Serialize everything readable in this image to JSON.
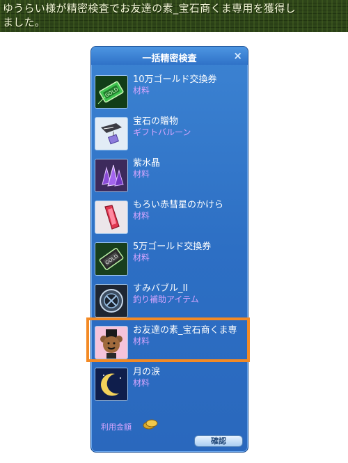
{
  "chat": {
    "message_line1": "ゆうらい様が精密検査でお友達の素_宝石商くま専用を獲得し",
    "message_line2": "ました。"
  },
  "dialog": {
    "title": "一括精密検査",
    "close_label": "×",
    "items": [
      {
        "name": "10万ゴールド交換券",
        "type": "材料",
        "icon": "gold-voucher-icon"
      },
      {
        "name": "宝石の贈物",
        "type": "ギフトバルーン",
        "icon": "gift-balloon-icon"
      },
      {
        "name": "紫水晶",
        "type": "材料",
        "icon": "amethyst-icon"
      },
      {
        "name": "もろい赤彗星のかけら",
        "type": "材料",
        "icon": "red-comet-shard-icon"
      },
      {
        "name": "5万ゴールド交換券",
        "type": "材料",
        "icon": "gold-voucher-icon"
      },
      {
        "name": "すみバブル_II",
        "type": "釣り補助アイテム",
        "icon": "ink-bubble-icon"
      },
      {
        "name": "お友達の素_宝石商くま専",
        "type": "材料",
        "icon": "jeweler-bear-icon"
      },
      {
        "name": "月の涙",
        "type": "材料",
        "icon": "moon-tear-icon"
      }
    ],
    "fee_label": "利用金額",
    "confirm_label": "確認"
  }
}
